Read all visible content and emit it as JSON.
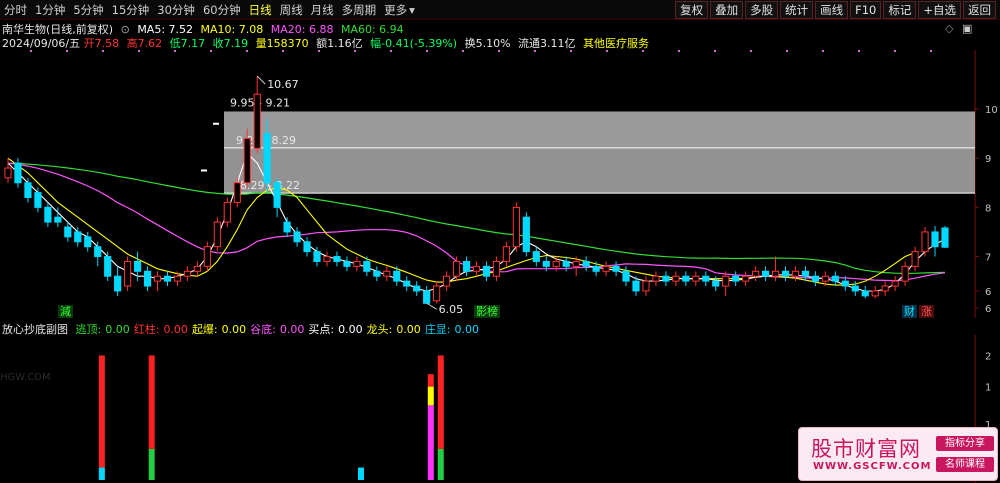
{
  "toolbar": {
    "periods": [
      "分时",
      "1分钟",
      "5分钟",
      "15分钟",
      "30分钟",
      "60分钟",
      "日线",
      "周线",
      "月线",
      "多周期",
      "更多"
    ],
    "active_period": "日线",
    "more_arrow": "▾",
    "right_buttons": [
      "复权",
      "叠加",
      "多股",
      "统计",
      "画线",
      "F10",
      "标记",
      "+自选",
      "返回"
    ]
  },
  "stock": {
    "name": "南华生物(日线,前复权)",
    "date": "2024/09/06/五",
    "open": "开7.58",
    "high": "高7.62",
    "low": "低7.17",
    "close": "收7.19",
    "volume": "量158370",
    "amount": "额1.16亿",
    "change": "幅-0.41(-5.39%)",
    "turnover": "换5.10%",
    "float": "流通3.11亿",
    "sector": "其他医疗服务"
  },
  "ma": {
    "ma5": "MA5: 7.52",
    "ma10": "MA10: 7.08",
    "ma20": "MA20: 6.88",
    "ma60": "MA60: 6.94"
  },
  "colors": {
    "up": "#ff3333",
    "down": "#00d8ff",
    "ma5": "#ffffff",
    "ma10": "#ffff00",
    "ma20": "#ff55ff",
    "ma60": "#33dd33",
    "zone": "#9a9a9a",
    "box_line": "#ffffff"
  },
  "annotations": {
    "high_price": "10.67",
    "low_price": "6.05",
    "zone1": "9.95 - 9.21",
    "zone2": "9.21 - 8.29",
    "zone3": "8.29 - 8.22"
  },
  "badges": {
    "b1": "減",
    "b2": "影榜",
    "b3": "财",
    "b4": "涨"
  },
  "sub": {
    "title": "放心抄底副图",
    "items": [
      {
        "label": "逃顶:",
        "value": "0.00",
        "color": "#33dd33"
      },
      {
        "label": "红柱:",
        "value": "0.00",
        "color": "#ff3333"
      },
      {
        "label": "起爆:",
        "value": "0.00",
        "color": "#ffff00"
      },
      {
        "label": "谷底:",
        "value": "0.00",
        "color": "#ff55ff"
      },
      {
        "label": "买点:",
        "value": "0.00",
        "color": "#ffffff"
      },
      {
        "label": "龙头:",
        "value": "0.00",
        "color": "#ffff00"
      },
      {
        "label": "庄显:",
        "value": "0.00",
        "color": "#00d8ff"
      }
    ]
  },
  "watermark": "HGW.COM",
  "logo": {
    "main": "股市财富网",
    "url": "WWW.GSCFW.COM",
    "tag1": "指标分享",
    "tag2": "名师课程"
  },
  "chart_data": [
    {
      "type": "candlestick",
      "title": "南华生物(日线,前复权)",
      "y_ticks": [
        "10",
        "9",
        "8",
        "7",
        "6",
        "6"
      ],
      "candles": [
        {
          "o": 8.6,
          "c": 8.8,
          "h": 9.0,
          "l": 8.5
        },
        {
          "o": 8.9,
          "c": 8.5,
          "h": 9.0,
          "l": 8.4
        },
        {
          "o": 8.5,
          "c": 8.2,
          "h": 8.6,
          "l": 8.1
        },
        {
          "o": 8.3,
          "c": 8.0,
          "h": 8.4,
          "l": 7.9
        },
        {
          "o": 8.0,
          "c": 7.7,
          "h": 8.1,
          "l": 7.6
        },
        {
          "o": 7.8,
          "c": 7.7,
          "h": 8.0,
          "l": 7.6
        },
        {
          "o": 7.6,
          "c": 7.4,
          "h": 7.7,
          "l": 7.3
        },
        {
          "o": 7.5,
          "c": 7.3,
          "h": 7.6,
          "l": 7.2
        },
        {
          "o": 7.4,
          "c": 7.2,
          "h": 7.5,
          "l": 7.1
        },
        {
          "o": 7.2,
          "c": 7.0,
          "h": 7.3,
          "l": 6.8
        },
        {
          "o": 7.0,
          "c": 6.6,
          "h": 7.1,
          "l": 6.5
        },
        {
          "o": 6.6,
          "c": 6.3,
          "h": 6.8,
          "l": 6.2
        },
        {
          "o": 6.4,
          "c": 6.9,
          "h": 7.0,
          "l": 6.3
        },
        {
          "o": 6.9,
          "c": 6.7,
          "h": 7.1,
          "l": 6.5
        },
        {
          "o": 6.7,
          "c": 6.4,
          "h": 6.8,
          "l": 6.3
        },
        {
          "o": 6.5,
          "c": 6.6,
          "h": 6.7,
          "l": 6.3
        },
        {
          "o": 6.6,
          "c": 6.5,
          "h": 6.7,
          "l": 6.4
        },
        {
          "o": 6.5,
          "c": 6.6,
          "h": 6.7,
          "l": 6.4
        },
        {
          "o": 6.6,
          "c": 6.7,
          "h": 6.8,
          "l": 6.5
        },
        {
          "o": 6.7,
          "c": 6.8,
          "h": 6.9,
          "l": 6.6
        },
        {
          "o": 6.8,
          "c": 7.2,
          "h": 7.3,
          "l": 6.7
        },
        {
          "o": 7.2,
          "c": 7.7,
          "h": 7.8,
          "l": 7.1
        },
        {
          "o": 7.7,
          "c": 8.1,
          "h": 8.2,
          "l": 7.6
        },
        {
          "o": 8.1,
          "c": 8.5,
          "h": 8.6,
          "l": 8.0
        },
        {
          "o": 8.5,
          "c": 9.4,
          "h": 9.6,
          "l": 8.4
        },
        {
          "o": 9.2,
          "c": 10.3,
          "h": 10.67,
          "l": 9.1
        },
        {
          "o": 9.5,
          "c": 8.5,
          "h": 9.8,
          "l": 8.3
        },
        {
          "o": 8.5,
          "c": 8.0,
          "h": 8.6,
          "l": 7.8
        },
        {
          "o": 7.7,
          "c": 7.5,
          "h": 7.8,
          "l": 7.4
        },
        {
          "o": 7.5,
          "c": 7.3,
          "h": 7.6,
          "l": 7.2
        },
        {
          "o": 7.3,
          "c": 7.1,
          "h": 7.4,
          "l": 7.0
        },
        {
          "o": 7.1,
          "c": 6.9,
          "h": 7.2,
          "l": 6.8
        },
        {
          "o": 6.9,
          "c": 7.0,
          "h": 7.1,
          "l": 6.8
        },
        {
          "o": 7.0,
          "c": 6.9,
          "h": 7.1,
          "l": 6.8
        },
        {
          "o": 6.9,
          "c": 6.8,
          "h": 7.0,
          "l": 6.7
        },
        {
          "o": 6.8,
          "c": 6.9,
          "h": 7.0,
          "l": 6.7
        },
        {
          "o": 6.9,
          "c": 6.7,
          "h": 7.0,
          "l": 6.6
        },
        {
          "o": 6.7,
          "c": 6.6,
          "h": 6.8,
          "l": 6.5
        },
        {
          "o": 6.6,
          "c": 6.7,
          "h": 6.8,
          "l": 6.5
        },
        {
          "o": 6.7,
          "c": 6.5,
          "h": 6.8,
          "l": 6.4
        },
        {
          "o": 6.5,
          "c": 6.4,
          "h": 6.6,
          "l": 6.3
        },
        {
          "o": 6.4,
          "c": 6.3,
          "h": 6.5,
          "l": 6.2
        },
        {
          "o": 6.3,
          "c": 6.05,
          "h": 6.4,
          "l": 6.05
        },
        {
          "o": 6.1,
          "c": 6.4,
          "h": 6.5,
          "l": 6.05
        },
        {
          "o": 6.4,
          "c": 6.6,
          "h": 6.7,
          "l": 6.3
        },
        {
          "o": 6.6,
          "c": 6.9,
          "h": 7.0,
          "l": 6.5
        },
        {
          "o": 6.9,
          "c": 6.7,
          "h": 7.0,
          "l": 6.6
        },
        {
          "o": 6.7,
          "c": 6.8,
          "h": 6.9,
          "l": 6.6
        },
        {
          "o": 6.8,
          "c": 6.6,
          "h": 6.9,
          "l": 6.5
        },
        {
          "o": 6.6,
          "c": 6.9,
          "h": 7.0,
          "l": 6.5
        },
        {
          "o": 6.9,
          "c": 7.2,
          "h": 7.3,
          "l": 6.8
        },
        {
          "o": 7.2,
          "c": 8.0,
          "h": 8.1,
          "l": 7.1
        },
        {
          "o": 7.8,
          "c": 7.1,
          "h": 7.9,
          "l": 7.0
        },
        {
          "o": 7.1,
          "c": 6.9,
          "h": 7.2,
          "l": 6.8
        },
        {
          "o": 6.9,
          "c": 6.8,
          "h": 7.0,
          "l": 6.7
        },
        {
          "o": 6.8,
          "c": 6.9,
          "h": 7.0,
          "l": 6.7
        },
        {
          "o": 6.9,
          "c": 6.8,
          "h": 7.0,
          "l": 6.7
        },
        {
          "o": 6.8,
          "c": 6.9,
          "h": 7.0,
          "l": 6.6
        },
        {
          "o": 6.9,
          "c": 6.8,
          "h": 7.0,
          "l": 6.7
        },
        {
          "o": 6.8,
          "c": 6.7,
          "h": 6.9,
          "l": 6.6
        },
        {
          "o": 6.7,
          "c": 6.8,
          "h": 6.9,
          "l": 6.6
        },
        {
          "o": 6.8,
          "c": 6.7,
          "h": 6.9,
          "l": 6.6
        },
        {
          "o": 6.7,
          "c": 6.5,
          "h": 6.8,
          "l": 6.4
        },
        {
          "o": 6.5,
          "c": 6.3,
          "h": 6.6,
          "l": 6.2
        },
        {
          "o": 6.3,
          "c": 6.5,
          "h": 6.6,
          "l": 6.2
        },
        {
          "o": 6.5,
          "c": 6.6,
          "h": 6.7,
          "l": 6.4
        },
        {
          "o": 6.6,
          "c": 6.5,
          "h": 6.7,
          "l": 6.4
        },
        {
          "o": 6.5,
          "c": 6.6,
          "h": 6.7,
          "l": 6.4
        },
        {
          "o": 6.6,
          "c": 6.5,
          "h": 6.7,
          "l": 6.4
        },
        {
          "o": 6.5,
          "c": 6.6,
          "h": 6.7,
          "l": 6.4
        },
        {
          "o": 6.6,
          "c": 6.5,
          "h": 6.7,
          "l": 6.4
        },
        {
          "o": 6.5,
          "c": 6.4,
          "h": 6.6,
          "l": 6.3
        },
        {
          "o": 6.4,
          "c": 6.6,
          "h": 6.7,
          "l": 6.2
        },
        {
          "o": 6.6,
          "c": 6.5,
          "h": 6.7,
          "l": 6.4
        },
        {
          "o": 6.5,
          "c": 6.6,
          "h": 6.7,
          "l": 6.4
        },
        {
          "o": 6.6,
          "c": 6.7,
          "h": 6.8,
          "l": 6.5
        },
        {
          "o": 6.7,
          "c": 6.6,
          "h": 6.8,
          "l": 6.5
        },
        {
          "o": 6.6,
          "c": 6.7,
          "h": 7.0,
          "l": 6.5
        },
        {
          "o": 6.7,
          "c": 6.6,
          "h": 6.8,
          "l": 6.5
        },
        {
          "o": 6.6,
          "c": 6.7,
          "h": 6.8,
          "l": 6.5
        },
        {
          "o": 6.7,
          "c": 6.6,
          "h": 6.8,
          "l": 6.5
        },
        {
          "o": 6.6,
          "c": 6.5,
          "h": 6.7,
          "l": 6.4
        },
        {
          "o": 6.5,
          "c": 6.6,
          "h": 6.7,
          "l": 6.4
        },
        {
          "o": 6.6,
          "c": 6.5,
          "h": 6.7,
          "l": 6.4
        },
        {
          "o": 6.5,
          "c": 6.4,
          "h": 6.6,
          "l": 6.3
        },
        {
          "o": 6.4,
          "c": 6.3,
          "h": 6.5,
          "l": 6.2
        },
        {
          "o": 6.3,
          "c": 6.2,
          "h": 6.4,
          "l": 6.15
        },
        {
          "o": 6.2,
          "c": 6.3,
          "h": 6.4,
          "l": 6.15
        },
        {
          "o": 6.3,
          "c": 6.4,
          "h": 6.5,
          "l": 6.2
        },
        {
          "o": 6.4,
          "c": 6.5,
          "h": 6.6,
          "l": 6.3
        },
        {
          "o": 6.5,
          "c": 6.8,
          "h": 6.9,
          "l": 6.4
        },
        {
          "o": 6.8,
          "c": 7.1,
          "h": 7.2,
          "l": 6.7
        },
        {
          "o": 7.1,
          "c": 7.5,
          "h": 7.6,
          "l": 7.0
        },
        {
          "o": 7.5,
          "c": 7.2,
          "h": 7.62,
          "l": 7.0
        },
        {
          "o": 7.58,
          "c": 7.19,
          "h": 7.62,
          "l": 7.17
        }
      ],
      "ma5": [
        8.9,
        8.7,
        8.5,
        8.3,
        8.1,
        7.9,
        7.7,
        7.5,
        7.4,
        7.2,
        7.0,
        6.8,
        6.7,
        6.6,
        6.6,
        6.55,
        6.55,
        6.6,
        6.65,
        6.75,
        7.0,
        7.4,
        7.9,
        8.5,
        9.1,
        8.9,
        8.5,
        8.1,
        7.7,
        7.45,
        7.25,
        7.1,
        7.0,
        6.95,
        6.9,
        6.85,
        6.78,
        6.7,
        6.62,
        6.55,
        6.45,
        6.35,
        6.3,
        6.35,
        6.45,
        6.6,
        6.7,
        6.72,
        6.75,
        6.8,
        6.95,
        7.2,
        7.3,
        7.2,
        7.05,
        6.95,
        6.9,
        6.85,
        6.82,
        6.78,
        6.75,
        6.72,
        6.65,
        6.55,
        6.5,
        6.5,
        6.52,
        6.55,
        6.55,
        6.55,
        6.55,
        6.52,
        6.5,
        6.52,
        6.54,
        6.58,
        6.6,
        6.62,
        6.63,
        6.62,
        6.6,
        6.57,
        6.55,
        6.5,
        6.42,
        6.35,
        6.3,
        6.3,
        6.33,
        6.45,
        6.65,
        6.9,
        7.1,
        7.25,
        7.35
      ],
      "ma10": [
        9.0,
        8.85,
        8.7,
        8.5,
        8.3,
        8.1,
        7.95,
        7.8,
        7.65,
        7.5,
        7.35,
        7.2,
        7.05,
        6.95,
        6.85,
        6.75,
        6.7,
        6.65,
        6.62,
        6.6,
        6.7,
        6.9,
        7.2,
        7.55,
        7.95,
        8.2,
        8.35,
        8.4,
        8.35,
        8.2,
        7.95,
        7.7,
        7.45,
        7.3,
        7.15,
        7.05,
        6.95,
        6.88,
        6.82,
        6.75,
        6.68,
        6.6,
        6.52,
        6.48,
        6.48,
        6.52,
        6.55,
        6.6,
        6.65,
        6.7,
        6.78,
        6.85,
        6.92,
        6.98,
        7.02,
        7.0,
        6.98,
        6.95,
        6.9,
        6.85,
        6.8,
        6.76,
        6.72,
        6.68,
        6.64,
        6.6,
        6.58,
        6.56,
        6.55,
        6.55,
        6.55,
        6.55,
        6.55,
        6.55,
        6.56,
        6.58,
        6.6,
        6.6,
        6.58,
        6.56,
        6.52,
        6.48,
        6.44,
        6.42,
        6.42,
        6.44,
        6.5,
        6.6,
        6.72,
        6.86,
        7.0,
        7.08
      ]
    },
    {
      "type": "bar",
      "title": "放心抄底副图",
      "y_ticks": [
        "2",
        "1",
        "1",
        "0"
      ],
      "bars": [
        {
          "i": 5,
          "segments": [
            {
              "color": "#00d8ff",
              "v": 0.2
            },
            {
              "color": "#ff2222",
              "v": 1.8
            }
          ]
        },
        {
          "i": 10,
          "segments": [
            {
              "color": "#22cc44",
              "v": 0.5
            },
            {
              "color": "#ff2222",
              "v": 1.5
            }
          ]
        },
        {
          "i": 31,
          "segments": [
            {
              "color": "#00d8ff",
              "v": 0.2
            }
          ]
        },
        {
          "i": 38,
          "segments": [
            {
              "color": "#ff33ff",
              "v": 1.2
            },
            {
              "color": "#ffff00",
              "v": 0.3
            },
            {
              "color": "#ff2222",
              "v": 0.2
            }
          ]
        },
        {
          "i": 39,
          "segments": [
            {
              "color": "#22cc44",
              "v": 0.5
            },
            {
              "color": "#ff2222",
              "v": 1.5
            }
          ]
        }
      ]
    }
  ]
}
